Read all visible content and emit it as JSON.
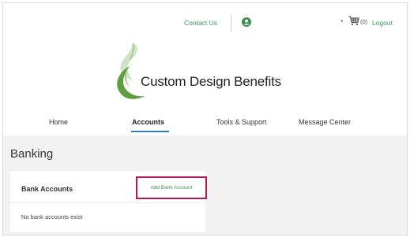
{
  "topbar": {
    "contact_label": "Contact Us",
    "cart_count": "(0)",
    "logout_label": "Logout"
  },
  "brand": {
    "name": "Custom Design Benefits",
    "accent": "#3a9a5a",
    "highlight_border": "#b3195a",
    "active_tab_underline": "#2f7fc0"
  },
  "nav": {
    "items": [
      {
        "label": "Home"
      },
      {
        "label": "Accounts"
      },
      {
        "label": "Tools & Support"
      },
      {
        "label": "Message Center"
      }
    ],
    "active": "Accounts"
  },
  "page": {
    "title": "Banking",
    "panel": {
      "title": "Bank Accounts",
      "add_label": "Add Bank Account",
      "empty_message": "No bank accounts exist"
    }
  },
  "icons": {
    "user": "user-icon",
    "dropdown": "chevron-down-icon",
    "cart": "cart-icon",
    "logo": "leaf-swirl-logo"
  }
}
